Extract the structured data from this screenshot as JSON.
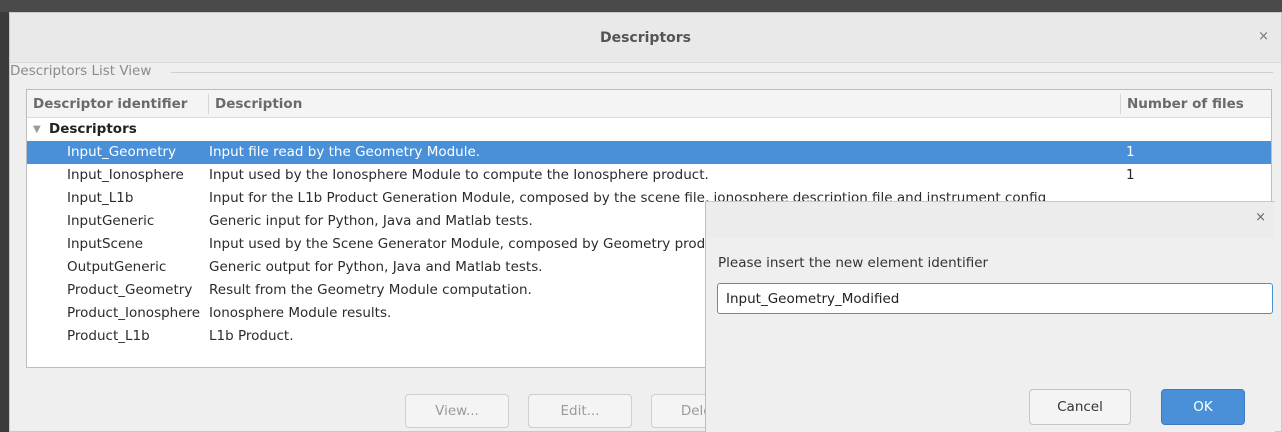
{
  "window": {
    "title": "Descriptors",
    "close_glyph": "×",
    "group_label": "Descriptors List View"
  },
  "table": {
    "columns": [
      "Descriptor identifier",
      "Description",
      "Number of files"
    ],
    "group": "Descriptors",
    "rows": [
      {
        "id": "Input_Geometry",
        "description": "Input file read by the Geometry Module.",
        "count": "1",
        "selected": true
      },
      {
        "id": "Input_Ionosphere",
        "description": "Input used by the Ionosphere Module to compute the Ionosphere product.",
        "count": "1"
      },
      {
        "id": "Input_L1b",
        "description": "Input for the L1b Product Generation Module, composed by the scene file, ionosphere description file and instrument config",
        "count": ""
      },
      {
        "id": "InputGeneric",
        "description": "Generic input for Python, Java and Matlab tests.",
        "count": ""
      },
      {
        "id": "InputScene",
        "description": "Input used by the Scene Generator Module, composed by Geometry product",
        "count": ""
      },
      {
        "id": "OutputGeneric",
        "description": "Generic output for Python, Java and Matlab tests.",
        "count": ""
      },
      {
        "id": "Product_Geometry",
        "description": "Result from the Geometry Module computation.",
        "count": ""
      },
      {
        "id": "Product_Ionosphere",
        "description": "Ionosphere Module results.",
        "count": ""
      },
      {
        "id": "Product_L1b",
        "description": "L1b Product.",
        "count": ""
      }
    ]
  },
  "buttons": {
    "view": "View...",
    "edit": "Edit...",
    "delete": "Delete"
  },
  "dialog": {
    "close_glyph": "×",
    "prompt": "Please insert the new element identifier",
    "input_value": "Input_Geometry_Modified",
    "cancel": "Cancel",
    "ok": "OK"
  },
  "colors": {
    "selection": "#4a90d9",
    "primary_button": "#4a90d9"
  }
}
